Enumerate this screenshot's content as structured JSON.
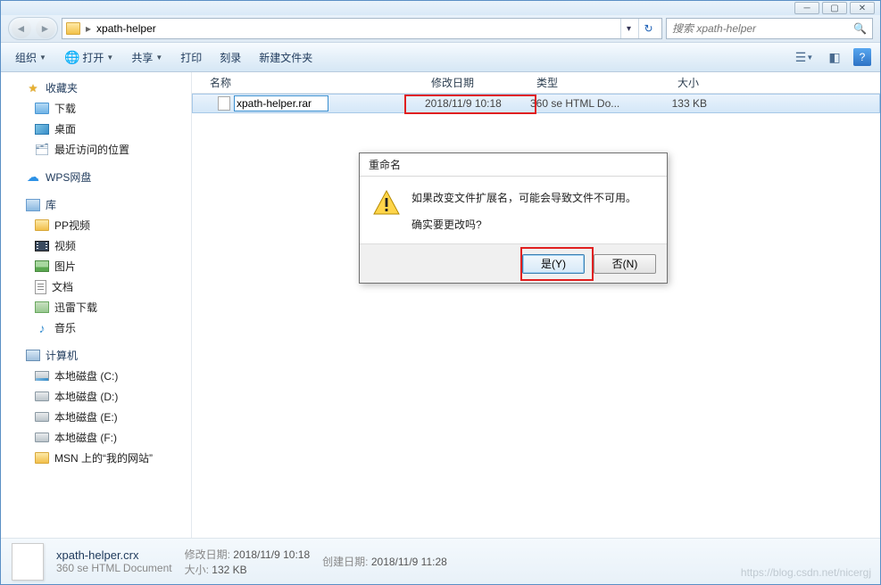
{
  "address": {
    "folder": "xpath-helper"
  },
  "search": {
    "placeholder": "搜索 xpath-helper"
  },
  "toolbar": {
    "organize": "组织",
    "open": "打开",
    "share": "共享",
    "print": "打印",
    "burn": "刻录",
    "newfolder": "新建文件夹"
  },
  "columns": {
    "name": "名称",
    "date": "修改日期",
    "type": "类型",
    "size": "大小"
  },
  "nav": {
    "favorites": "收藏夹",
    "downloads": "下载",
    "desktop": "桌面",
    "recent": "最近访问的位置",
    "wps": "WPS网盘",
    "libraries": "库",
    "pp": "PP视频",
    "videos": "视频",
    "pictures": "图片",
    "documents": "文档",
    "xunlei": "迅雷下载",
    "music": "音乐",
    "computer": "计算机",
    "cdrive": "本地磁盘 (C:)",
    "ddrive": "本地磁盘 (D:)",
    "edrive": "本地磁盘 (E:)",
    "fdrive": "本地磁盘 (F:)",
    "msn": "MSN 上的“我的网站”"
  },
  "file": {
    "rename_value": "xpath-helper.rar",
    "date": "2018/11/9 10:18",
    "type": "360 se HTML Do...",
    "size": "133 KB"
  },
  "details": {
    "name": "xpath-helper.crx",
    "type": "360 se HTML Document",
    "moddate_label": "修改日期:",
    "moddate": "2018/11/9 10:18",
    "created_label": "创建日期:",
    "created": "2018/11/9 11:28",
    "size_label": "大小:",
    "size": "132 KB"
  },
  "dialog": {
    "title": "重命名",
    "line1": "如果改变文件扩展名，可能会导致文件不可用。",
    "line2": "确实要更改吗?",
    "yes": "是(Y)",
    "no": "否(N)"
  },
  "watermark": "https://blog.csdn.net/nicergj"
}
